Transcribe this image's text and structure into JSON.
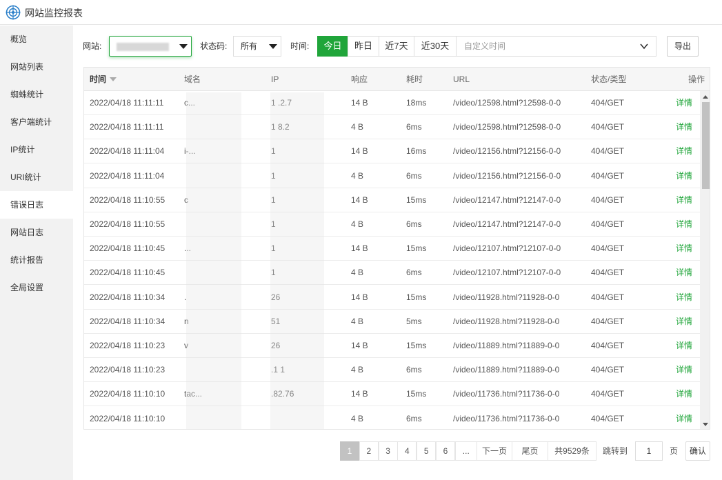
{
  "window": {
    "title": "网站监控报表"
  },
  "sidebar": {
    "items": [
      {
        "label": "概览",
        "active": false
      },
      {
        "label": "网站列表",
        "active": false
      },
      {
        "label": "蜘蛛统计",
        "active": false
      },
      {
        "label": "客户端统计",
        "active": false
      },
      {
        "label": "IP统计",
        "active": false
      },
      {
        "label": "URI统计",
        "active": false
      },
      {
        "label": "错误日志",
        "active": true
      },
      {
        "label": "网站日志",
        "active": false
      },
      {
        "label": "统计报告",
        "active": false
      },
      {
        "label": "全局设置",
        "active": false
      }
    ]
  },
  "filters": {
    "site_label": "网站:",
    "status_label": "状态码:",
    "status_value": "所有",
    "time_label": "时间:",
    "time_buttons": [
      {
        "label": "今日",
        "active": true
      },
      {
        "label": "昨日",
        "active": false
      },
      {
        "label": "近7天",
        "active": false
      },
      {
        "label": "近30天",
        "active": false
      }
    ],
    "custom_time_placeholder": "自定义时间",
    "export_label": "导出"
  },
  "table": {
    "columns": [
      "时间",
      "域名",
      "IP",
      "响应",
      "耗时",
      "URL",
      "状态/类型",
      "操作"
    ],
    "rows": [
      {
        "time": "2022/04/18 11:11:11",
        "domain": "c...",
        "ip": "1 .2.7",
        "size": "14 B",
        "cost": "18ms",
        "url": "/video/12598.html?12598-0-0",
        "status": "404/GET",
        "action": "详情"
      },
      {
        "time": "2022/04/18 11:11:11",
        "domain": "",
        "ip": "1 8.2",
        "size": "4 B",
        "cost": "6ms",
        "url": "/video/12598.html?12598-0-0",
        "status": "404/GET",
        "action": "详情"
      },
      {
        "time": "2022/04/18 11:11:04",
        "domain": "i-...",
        "ip": "1",
        "size": "14 B",
        "cost": "16ms",
        "url": "/video/12156.html?12156-0-0",
        "status": "404/GET",
        "action": "详情"
      },
      {
        "time": "2022/04/18 11:11:04",
        "domain": "",
        "ip": "1",
        "size": "4 B",
        "cost": "6ms",
        "url": "/video/12156.html?12156-0-0",
        "status": "404/GET",
        "action": "详情"
      },
      {
        "time": "2022/04/18 11:10:55",
        "domain": "c",
        "ip": "1",
        "size": "14 B",
        "cost": "15ms",
        "url": "/video/12147.html?12147-0-0",
        "status": "404/GET",
        "action": "详情"
      },
      {
        "time": "2022/04/18 11:10:55",
        "domain": "",
        "ip": "1",
        "size": "4 B",
        "cost": "6ms",
        "url": "/video/12147.html?12147-0-0",
        "status": "404/GET",
        "action": "详情"
      },
      {
        "time": "2022/04/18 11:10:45",
        "domain": "...",
        "ip": "1",
        "size": "14 B",
        "cost": "15ms",
        "url": "/video/12107.html?12107-0-0",
        "status": "404/GET",
        "action": "详情"
      },
      {
        "time": "2022/04/18 11:10:45",
        "domain": "",
        "ip": "1",
        "size": "4 B",
        "cost": "6ms",
        "url": "/video/12107.html?12107-0-0",
        "status": "404/GET",
        "action": "详情"
      },
      {
        "time": "2022/04/18 11:10:34",
        "domain": ".",
        "ip": "26",
        "size": "14 B",
        "cost": "15ms",
        "url": "/video/11928.html?11928-0-0",
        "status": "404/GET",
        "action": "详情"
      },
      {
        "time": "2022/04/18 11:10:34",
        "domain": "n",
        "ip": "51",
        "size": "4 B",
        "cost": "5ms",
        "url": "/video/11928.html?11928-0-0",
        "status": "404/GET",
        "action": "详情"
      },
      {
        "time": "2022/04/18 11:10:23",
        "domain": "v",
        "ip": "26",
        "size": "14 B",
        "cost": "15ms",
        "url": "/video/11889.html?11889-0-0",
        "status": "404/GET",
        "action": "详情"
      },
      {
        "time": "2022/04/18 11:10:23",
        "domain": "",
        "ip": ".1 1",
        "size": "4 B",
        "cost": "6ms",
        "url": "/video/11889.html?11889-0-0",
        "status": "404/GET",
        "action": "详情"
      },
      {
        "time": "2022/04/18 11:10:10",
        "domain": "tac...",
        "ip": ".82.76",
        "size": "14 B",
        "cost": "15ms",
        "url": "/video/11736.html?11736-0-0",
        "status": "404/GET",
        "action": "详情"
      },
      {
        "time": "2022/04/18 11:10:10",
        "domain": "",
        "ip": "",
        "size": "4 B",
        "cost": "6ms",
        "url": "/video/11736.html?11736-0-0",
        "status": "404/GET",
        "action": "详情"
      }
    ]
  },
  "pagination": {
    "pages": [
      {
        "label": "1",
        "active": true
      },
      {
        "label": "2",
        "active": false
      },
      {
        "label": "3",
        "active": false
      },
      {
        "label": "4",
        "active": false
      },
      {
        "label": "5",
        "active": false
      },
      {
        "label": "6",
        "active": false
      },
      {
        "label": "...",
        "active": false
      }
    ],
    "next_label": "下一页",
    "last_label": "尾页",
    "total_label": "共9529条",
    "jump_label": "跳转到",
    "jump_value": "1",
    "page_unit": "页",
    "confirm_label": "确认"
  },
  "colors": {
    "accent": "#20a53a",
    "sidebar_bg": "#f2f2f2"
  }
}
